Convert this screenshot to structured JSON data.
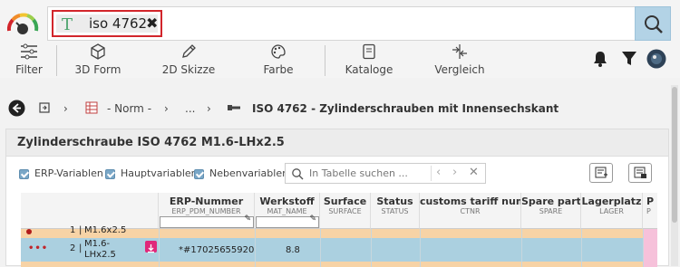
{
  "search": {
    "query": "iso 4762"
  },
  "toolbar": {
    "filter": "Filter",
    "form3d": "3D Form",
    "sketch2d": "2D Skizze",
    "color": "Farbe",
    "catalogs": "Kataloge",
    "compare": "Vergleich"
  },
  "breadcrumb": {
    "norm": "- Norm -",
    "ellipsis": "...",
    "current": "ISO 4762 - Zylinderschrauben mit Innensechskant"
  },
  "panel": {
    "title": "Zylinderschraube ISO 4762 M1.6-LHx2.5",
    "options": {
      "erp": "ERP-Variablen",
      "main": "Hauptvariablen",
      "secondary": "Nebenvariablen"
    },
    "table_search_placeholder": "In Tabelle suchen ..."
  },
  "table": {
    "columns": [
      {
        "title": "ERP-Nummer",
        "sub": "ERP_PDM_NUMBER"
      },
      {
        "title": "Werkstoff",
        "sub": "MAT_NAME"
      },
      {
        "title": "Surface",
        "sub": "SURFACE"
      },
      {
        "title": "Status",
        "sub": "STATUS"
      },
      {
        "title": "customs tariff num...",
        "sub": "CTNR"
      },
      {
        "title": "Spare part",
        "sub": "SPARE"
      },
      {
        "title": "Lagerplatz",
        "sub": "LAGER"
      },
      {
        "title": "P",
        "sub": "P"
      }
    ],
    "rows": [
      {
        "index": "1",
        "name": "M1.6x2.5",
        "erp": "",
        "mat": ""
      },
      {
        "index": "2",
        "name": "M1.6-\nLHx2.5",
        "name_line1": "M1.6-",
        "name_line2": "LHx2.5",
        "erp": "*#17025655920",
        "mat": "8.8"
      }
    ]
  },
  "colors": {
    "accent_red": "#d2252b",
    "search_button": "#b3d3e6",
    "row_selected": "#abd0e0",
    "row_orange": "#f7d3a6",
    "checkbox": "#7aa7c7"
  },
  "icons": [
    "gauge-icon",
    "text-type-icon",
    "clear-icon",
    "search-icon",
    "filter-sliders-icon",
    "cube-icon",
    "pencil-icon",
    "palette-icon",
    "catalog-icon",
    "compare-icon",
    "bell-icon",
    "funnel-icon",
    "avatar-icon",
    "back-arrow-icon",
    "home-icon",
    "table-icon",
    "screw-icon",
    "chevron-right-icon",
    "add-row-icon",
    "export-icon",
    "download-icon"
  ]
}
